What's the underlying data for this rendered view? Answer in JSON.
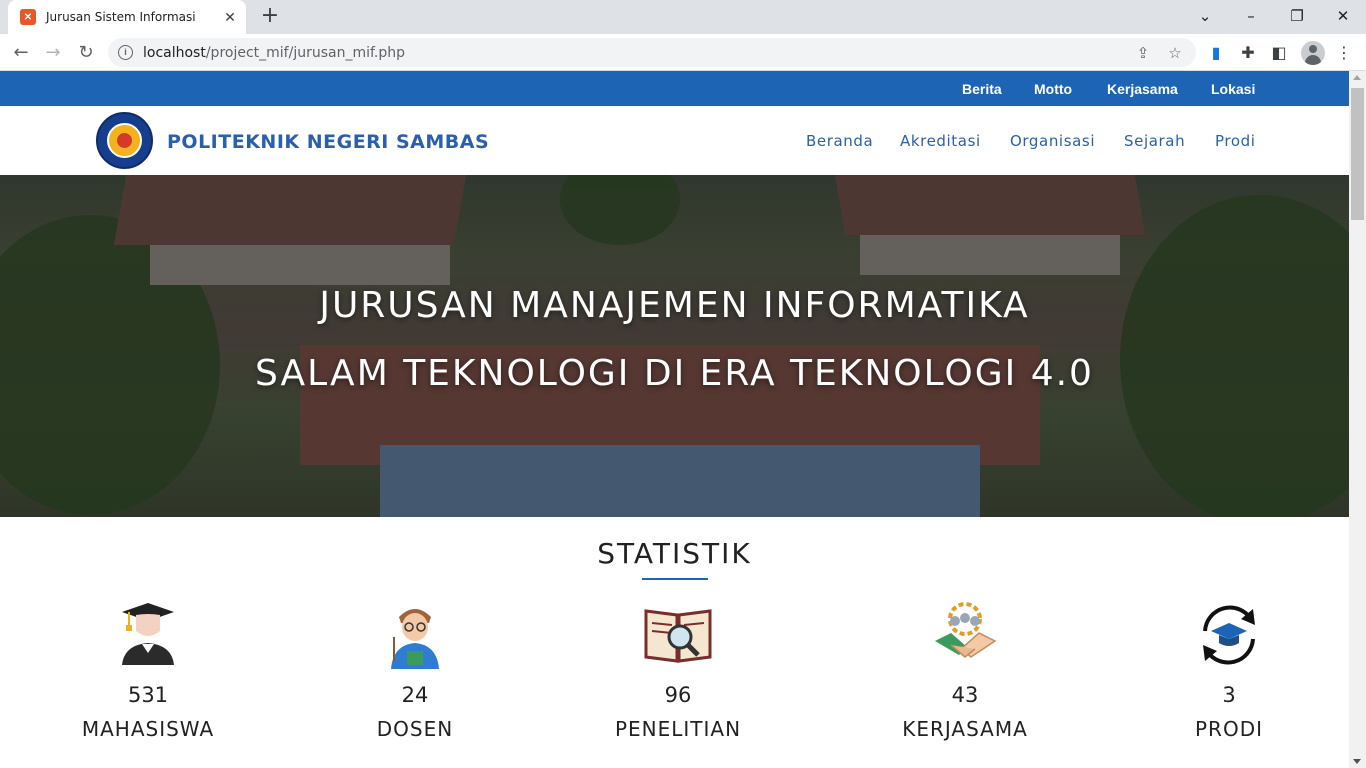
{
  "browser": {
    "tab_title": "Jurusan Sistem Informasi",
    "url_host": "localhost",
    "url_path": "/project_mif/jurusan_mif.php"
  },
  "topbar": {
    "links": [
      "Berita",
      "Motto",
      "Kerjasama",
      "Lokasi"
    ]
  },
  "header": {
    "brand": "POLITEKNIK NEGERI SAMBAS",
    "menu": [
      "Beranda",
      "Akreditasi",
      "Organisasi",
      "Sejarah",
      "Prodi"
    ]
  },
  "hero": {
    "line1": "JURUSAN MANAJEMEN INFORMATIKA",
    "line2": "SALAM TEKNOLOGI DI ERA TEKNOLOGI 4.0"
  },
  "statistik": {
    "title": "STATISTIK",
    "items": [
      {
        "value": "531",
        "label": "MAHASISWA",
        "icon": "graduate-icon"
      },
      {
        "value": "24",
        "label": "DOSEN",
        "icon": "teacher-icon"
      },
      {
        "value": "96",
        "label": "PENELITIAN",
        "icon": "research-book-icon"
      },
      {
        "value": "43",
        "label": "KERJASAMA",
        "icon": "handshake-icon"
      },
      {
        "value": "3",
        "label": "PRODI",
        "icon": "graduation-cycle-icon"
      }
    ]
  },
  "colors": {
    "primary": "#1e64b4",
    "brand_text": "#2a5fae"
  }
}
